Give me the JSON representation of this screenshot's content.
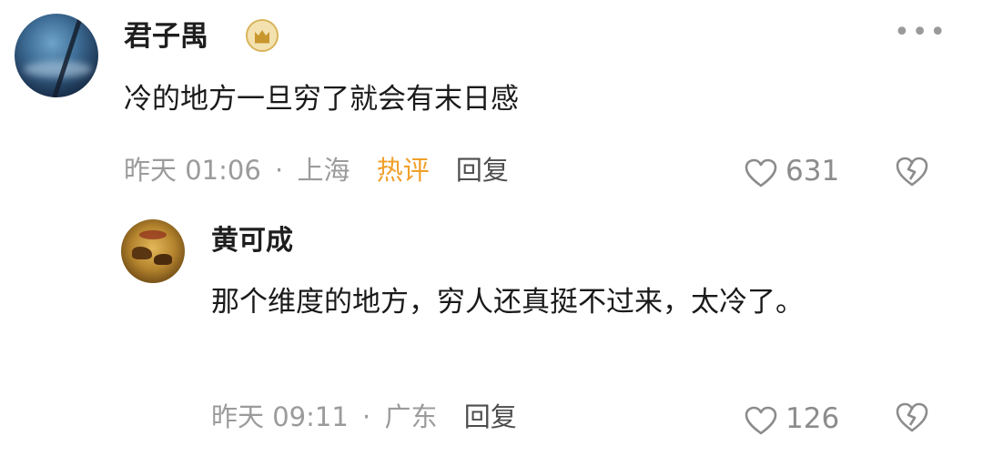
{
  "comment": {
    "author": "君子禺",
    "text": "冷的地方一旦穷了就会有末日感",
    "time": "昨天 01:06",
    "separator": "·",
    "location": "上海",
    "hot_label": "热评",
    "reply_label": "回复",
    "likes": "631",
    "more_label": "•••"
  },
  "reply": {
    "author": "黄可成",
    "text": "那个维度的地方，穷人还真挺不过来，太冷了。",
    "time": "昨天 09:11",
    "separator": "·",
    "location": "广东",
    "reply_label": "回复",
    "likes": "126"
  },
  "colors": {
    "hot_accent": "#f0a02a",
    "meta_gray": "#9b9b9b",
    "badge_gold": "#d8b45a"
  },
  "icons": {
    "badge": "crown-badge-icon",
    "like": "heart-outline-icon",
    "dislike": "broken-heart-icon",
    "more": "more-dots-icon"
  }
}
